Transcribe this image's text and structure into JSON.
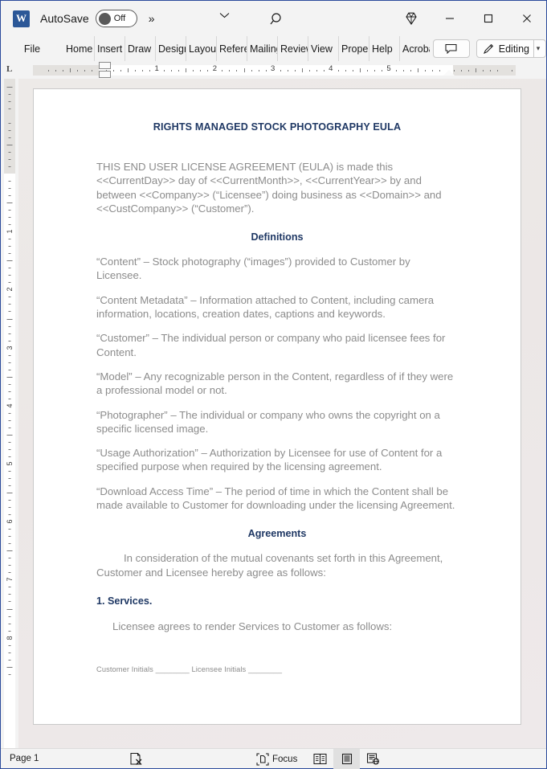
{
  "titlebar": {
    "app_icon": "word-icon",
    "autosave_label": "AutoSave",
    "autosave_state": "Off",
    "overflow_label": "»",
    "chevron_icon": "chevron-down-icon",
    "search_icon": "search-icon",
    "copilot_icon": "diamond-icon",
    "minimize_icon": "minimize-icon",
    "maximize_icon": "maximize-icon",
    "close_icon": "close-icon"
  },
  "ribbon": {
    "tabs": [
      {
        "label": "File"
      },
      {
        "label": "Home"
      },
      {
        "label": "Insert"
      },
      {
        "label": "Draw"
      },
      {
        "label": "Design"
      },
      {
        "label": "Layout"
      },
      {
        "label": "References"
      },
      {
        "label": "Mailings"
      },
      {
        "label": "Review"
      },
      {
        "label": "View"
      },
      {
        "label": "Properties"
      },
      {
        "label": "Help"
      },
      {
        "label": "Acrobat"
      }
    ],
    "comments_icon": "comment-icon",
    "editing_label": "Editing",
    "editing_icon": "pencil-icon",
    "editing_chevron": "chevron-down-icon"
  },
  "ruler": {
    "tab_stop_label": "L",
    "numbers": [
      "1",
      "2",
      "3",
      "4",
      "5"
    ],
    "vertical_numbers": [
      "1",
      "2",
      "3",
      "4",
      "5",
      "6",
      "7",
      "8"
    ]
  },
  "document": {
    "title": "RIGHTS MANAGED STOCK PHOTOGRAPHY EULA",
    "intro": "THIS END USER LICENSE AGREEMENT (EULA) is made this <<CurrentDay>> day of <<CurrentMonth>>, <<CurrentYear>> by and between <<Company>> (“Licensee”) doing business as <<Domain>> and <<CustCompany>> (“Customer”).",
    "definitions_heading": "Definitions",
    "definitions": [
      "“Content” – Stock photography (“images”) provided to Customer by Licensee.",
      "“Content Metadata” – Information attached to Content, including camera information, locations, creation dates, captions and keywords.",
      "“Customer” – The individual person or company who paid licensee fees for Content.",
      "“Model” – Any recognizable person in the Content, regardless of if they were a professional model or not.",
      "“Photographer” – The individual or company who owns the copyright on a specific licensed image.",
      "“Usage Authorization” – Authorization by Licensee for use of Content for a specified purpose when required by the licensing agreement.",
      "“Download Access Time” – The period of time in which the Content shall be made available to Customer for downloading under the licensing Agreement."
    ],
    "agreements_heading": "Agreements",
    "agreements_intro": "In consideration of the mutual covenants set forth in this Agreement, Customer and Licensee hereby agree as follows:",
    "services_heading": "1. Services.",
    "services_body": "Licensee agrees to render Services to Customer as follows:",
    "initials_line": "Customer Initials ________   Licensee Initials ________"
  },
  "statusbar": {
    "page_label": "Page 1",
    "proofing_icon": "proofing-errors-icon",
    "focus_label": "Focus",
    "focus_icon": "focus-icon",
    "read_mode_icon": "read-mode-icon",
    "print_layout_icon": "print-layout-icon",
    "web_layout_icon": "web-layout-icon"
  },
  "colors": {
    "heading": "#1f3864",
    "body_text": "#8c8c8c",
    "window_border": "#2b4a9b",
    "chrome": "#f3f3f3"
  }
}
